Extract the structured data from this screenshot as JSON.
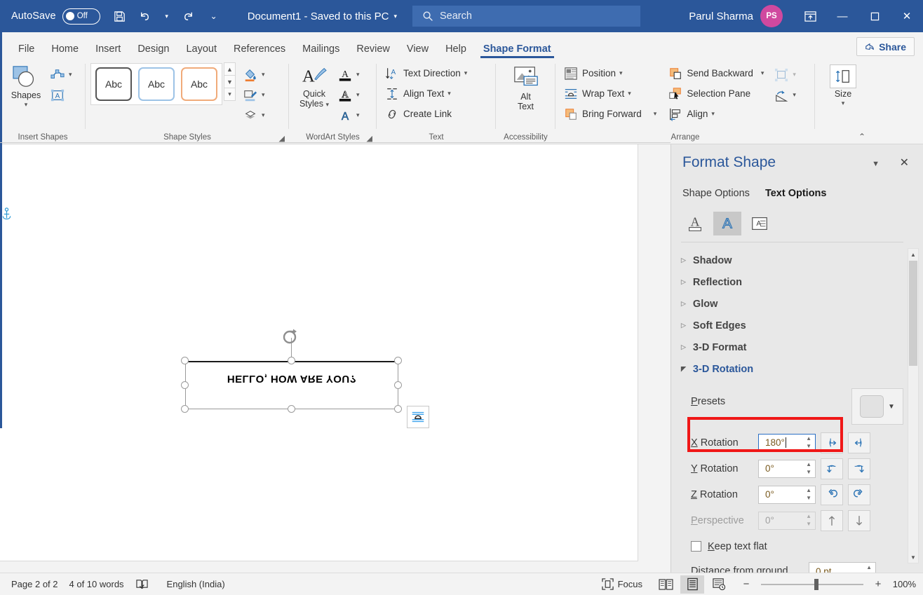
{
  "titlebar": {
    "autosave_label": "AutoSave",
    "autosave_state": "Off",
    "save_icon": "save-icon",
    "undo_icon": "undo-icon",
    "redo_icon": "redo-icon",
    "qat_more_icon": "quick-access-more-icon",
    "document_title": "Document1  -  Saved to this PC",
    "title_caret": "▾",
    "search_placeholder": "Search",
    "search_icon": "search-icon",
    "user_name": "Parul Sharma",
    "avatar_initials": "PS",
    "ribbon_display_icon": "ribbon-display-options-icon",
    "minimize": "—",
    "maximize": "❑",
    "close": "✕",
    "bg_color": "#2b579a"
  },
  "tabs": [
    {
      "label": "File",
      "active": false
    },
    {
      "label": "Home",
      "active": false
    },
    {
      "label": "Insert",
      "active": false
    },
    {
      "label": "Design",
      "active": false
    },
    {
      "label": "Layout",
      "active": false
    },
    {
      "label": "References",
      "active": false
    },
    {
      "label": "Mailings",
      "active": false
    },
    {
      "label": "Review",
      "active": false
    },
    {
      "label": "View",
      "active": false
    },
    {
      "label": "Help",
      "active": false
    },
    {
      "label": "Shape Format",
      "active": true
    }
  ],
  "share": {
    "label": "Share",
    "icon": "share-icon"
  },
  "ribbon": {
    "groups": [
      {
        "name": "Insert Shapes"
      },
      {
        "name": "Shape Styles"
      },
      {
        "name": "WordArt Styles"
      },
      {
        "name": "Text"
      },
      {
        "name": "Accessibility"
      },
      {
        "name": "Arrange"
      },
      {
        "name": ""
      }
    ],
    "shapes_button": "Shapes",
    "edit_shape_icon": "edit-shape-icon",
    "draw_textbox_icon": "draw-text-box-icon",
    "style_tiles": [
      "Abc",
      "Abc",
      "Abc"
    ],
    "shape_fill_icon": "shape-fill-icon",
    "shape_outline_icon": "shape-outline-icon",
    "shape_effects_icon": "shape-effects-icon",
    "quick_styles": "Quick\nStyles",
    "quick_styles_line1": "Quick",
    "quick_styles_line2": "Styles",
    "text_fill_icon": "text-fill-icon",
    "text_outline_icon": "text-outline-icon",
    "text_effects_icon": "text-effects-icon",
    "text_direction": "Text Direction",
    "align_text": "Align Text",
    "create_link": "Create Link",
    "alt_text_line1": "Alt",
    "alt_text_line2": "Text",
    "position": "Position",
    "wrap_text": "Wrap Text",
    "bring_forward": "Bring Forward",
    "send_backward": "Send Backward",
    "selection_pane": "Selection Pane",
    "align": "Align",
    "group_icon": "group-objects-icon",
    "rotate_icon": "rotate-objects-icon",
    "size_label": "Size",
    "collapse_ribbon": "⌃"
  },
  "document": {
    "shape_text": "HELLO, HOW ARE YOU?",
    "anchor_icon": "object-anchor-icon",
    "rotate_handle_icon": "rotation-handle-icon",
    "layout_options_icon": "layout-options-icon"
  },
  "pane": {
    "title": "Format Shape",
    "dropdown_icon": "pane-dropdown-icon",
    "close_icon": "close-icon",
    "tabs": [
      {
        "label": "Shape Options",
        "active": false
      },
      {
        "label": "Text Options",
        "active": true
      }
    ],
    "icon_tabs": [
      {
        "name": "text-fill-outline-icon",
        "selected": false
      },
      {
        "name": "text-effects-icon",
        "selected": true
      },
      {
        "name": "textbox-layout-icon",
        "selected": false
      }
    ],
    "sections": [
      {
        "label": "Shadow",
        "open": false
      },
      {
        "label": "Reflection",
        "open": false
      },
      {
        "label": "Glow",
        "open": false
      },
      {
        "label": "Soft Edges",
        "open": false
      },
      {
        "label": "3-D Format",
        "open": false
      },
      {
        "label": "3-D Rotation",
        "open": true
      }
    ],
    "rotation": {
      "presets_label": "Presets",
      "presets_dropdown_icon": "presets-dropdown-icon",
      "x_label_first": "X",
      "x_label_rest": " Rotation",
      "x_value": "180°",
      "y_label_first": "Y",
      "y_label_rest": " Rotation",
      "y_value": "0°",
      "z_label_first": "Z",
      "z_label_rest": " Rotation",
      "z_value": "0°",
      "perspective_label_first": "P",
      "perspective_label_rest": "erspective",
      "perspective_value": "0°",
      "keep_text_flat_first": "K",
      "keep_text_flat_rest": "eep text flat",
      "keep_text_flat_checked": false,
      "distance_label": "Distance from ground",
      "distance_value": "0 pt",
      "x_left_icon": "rotate-x-left-icon",
      "x_right_icon": "rotate-x-right-icon",
      "y_up_icon": "rotate-y-up-icon",
      "y_down_icon": "rotate-y-down-icon",
      "z_ccw_icon": "rotate-z-counterclockwise-icon",
      "z_cw_icon": "rotate-z-clockwise-icon",
      "persp_narrow_icon": "perspective-narrow-icon",
      "persp_widen_icon": "perspective-widen-icon",
      "highlight_color": "#f01717"
    }
  },
  "statusbar": {
    "page_info": "Page 2 of 2",
    "word_count": "4 of 10 words",
    "proofing_icon": "proofing-errors-icon",
    "language": "English (India)",
    "focus_label": "Focus",
    "focus_icon": "focus-mode-icon",
    "read_mode_icon": "read-mode-icon",
    "print_layout_icon": "print-layout-icon",
    "web_layout_icon": "web-layout-icon",
    "zoom_out": "−",
    "zoom_in": "+",
    "zoom_level": "100%"
  }
}
